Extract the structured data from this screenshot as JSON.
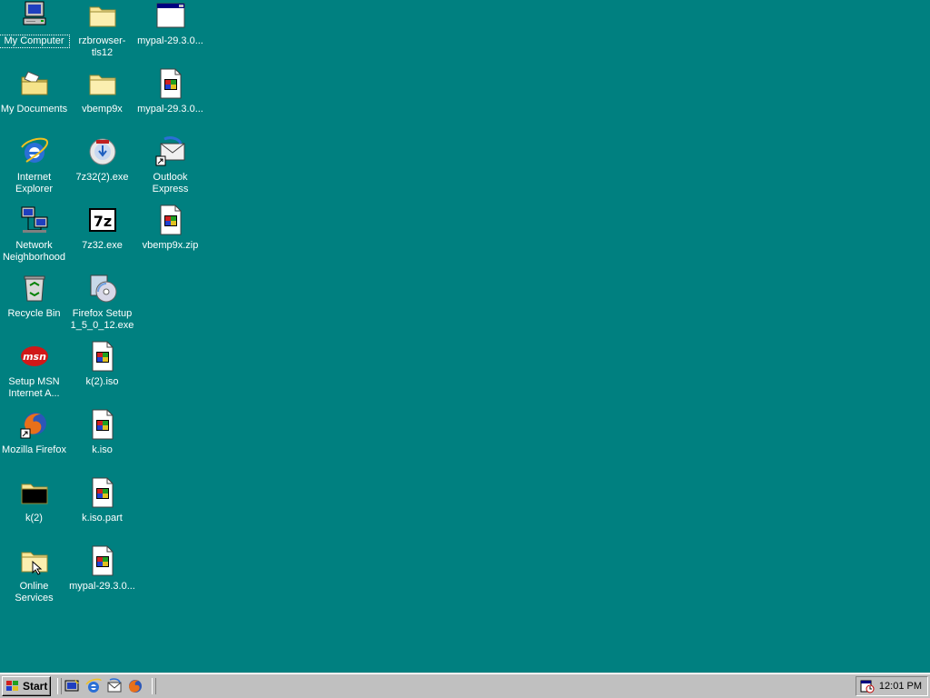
{
  "desktop": {
    "background_color": "#008080",
    "icons": [
      {
        "label": "My Computer",
        "icon": "my-computer-icon",
        "selected": true
      },
      {
        "label": "My Documents",
        "icon": "my-documents-icon"
      },
      {
        "label": "Internet Explorer",
        "icon": "internet-explorer-icon"
      },
      {
        "label": "Network Neighborhood",
        "icon": "network-neighborhood-icon"
      },
      {
        "label": "Recycle Bin",
        "icon": "recycle-bin-icon"
      },
      {
        "label": "Setup MSN Internet A...",
        "icon": "msn-icon"
      },
      {
        "label": "Mozilla Firefox",
        "icon": "firefox-icon"
      },
      {
        "label": "k(2)",
        "icon": "folder-icon"
      },
      {
        "label": "Online Services",
        "icon": "folder-icon"
      },
      {
        "label": "rzbrowser-tls12",
        "icon": "folder-icon"
      },
      {
        "label": "vbemp9x",
        "icon": "folder-icon"
      },
      {
        "label": "7z32(2).exe",
        "icon": "installer-icon"
      },
      {
        "label": "7z32.exe",
        "icon": "7zip-icon"
      },
      {
        "label": "Firefox Setup 1_5_0_12.exe",
        "icon": "setup-icon"
      },
      {
        "label": "k(2).iso",
        "icon": "file-icon"
      },
      {
        "label": "k.iso",
        "icon": "file-icon"
      },
      {
        "label": "k.iso.part",
        "icon": "file-icon"
      },
      {
        "label": "mypal-29.3.0...",
        "icon": "file-icon"
      },
      {
        "label": "mypal-29.3.0...",
        "icon": "window-icon"
      },
      {
        "label": "mypal-29.3.0...",
        "icon": "file-icon"
      },
      {
        "label": "Outlook Express",
        "icon": "outlook-express-icon"
      },
      {
        "label": "vbemp9x.zip",
        "icon": "file-icon"
      }
    ]
  },
  "taskbar": {
    "start_label": "Start",
    "quick_launch": [
      "show-desktop-icon",
      "internet-explorer-icon",
      "outlook-express-icon",
      "firefox-icon"
    ],
    "tray_icon": "scheduler-icon",
    "clock": "12:01 PM"
  }
}
